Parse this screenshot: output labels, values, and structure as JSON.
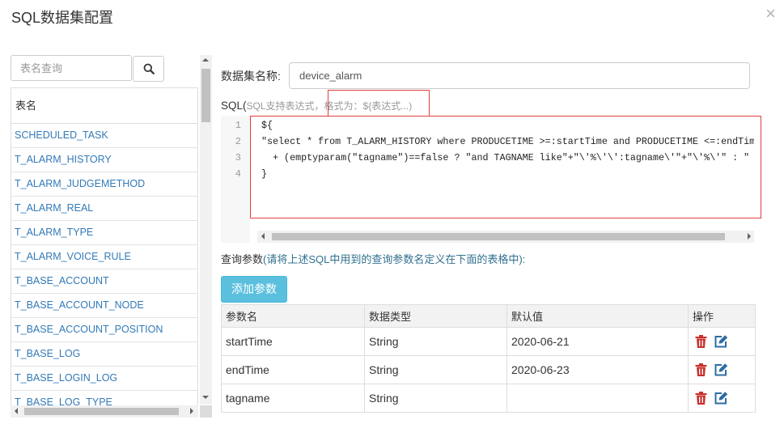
{
  "dialog": {
    "title": "SQL数据集配置",
    "close_label": "×"
  },
  "tables": {
    "search_placeholder": "表名查询",
    "header": "表名",
    "items": [
      "SCHEDULED_TASK",
      "T_ALARM_HISTORY",
      "T_ALARM_JUDGEMETHOD",
      "T_ALARM_REAL",
      "T_ALARM_TYPE",
      "T_ALARM_VOICE_RULE",
      "T_BASE_ACCOUNT",
      "T_BASE_ACCOUNT_NODE",
      "T_BASE_ACCOUNT_POSITION",
      "T_BASE_LOG",
      "T_BASE_LOGIN_LOG",
      "T_BASE_LOG_TYPE"
    ]
  },
  "dataset": {
    "name_label": "数据集名称:",
    "name_value": "device_alarm"
  },
  "sql": {
    "label": "SQL(",
    "hint": "SQL支持表达式，格式为：${表达式...)",
    "lines": [
      {
        "num": "1",
        "code": "${"
      },
      {
        "num": "2",
        "code": "\"select * from T_ALARM_HISTORY where PRODUCETIME >=:startTime and PRODUCETIME <=:endTim"
      },
      {
        "num": "3",
        "code": "  + (emptyparam(\"tagname\")==false ? \"and TAGNAME like\"+\"\\'%\\'\\':tagname\\'\"+\"\\'%\\'\" : \""
      },
      {
        "num": "4",
        "code": "}"
      }
    ]
  },
  "params": {
    "label": "查询参数",
    "hint": "(请将上述SQL中用到的查询参数名定义在下面的表格中):",
    "add_button": "添加参数",
    "columns": [
      "参数名",
      "数据类型",
      "默认值",
      "操作"
    ],
    "rows": [
      {
        "name": "startTime",
        "type": "String",
        "default": "2020-06-21"
      },
      {
        "name": "endTime",
        "type": "String",
        "default": "2020-06-23"
      },
      {
        "name": "tagname",
        "type": "String",
        "default": ""
      }
    ]
  },
  "icons": {
    "search": "search-icon",
    "close": "close-icon",
    "delete": "trash-icon",
    "edit": "edit-icon"
  },
  "colors": {
    "link": "#337ab7",
    "accent_button": "#5bc0de",
    "danger": "#c9302c",
    "edit": "#2e6da4",
    "highlight_outline": "#e33e3e",
    "hint_text": "#31708f"
  }
}
